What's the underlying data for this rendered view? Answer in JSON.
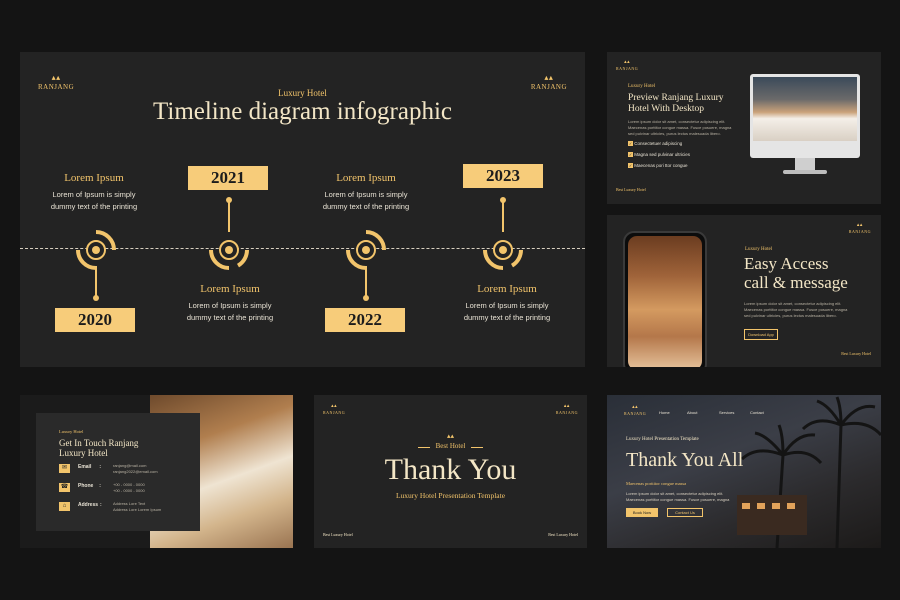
{
  "brand": "RANJANG",
  "timeline_slide": {
    "eyebrow": "Luxury Hotel",
    "title": "Timeline diagram infographic",
    "items": [
      {
        "year": "2020",
        "heading": "Lorem Ipsum",
        "text_l1": "Lorem of Ipsum is simply",
        "text_l2": "dummy text of the printing"
      },
      {
        "year": "2021",
        "heading": "Lorem Ipsum",
        "text_l1": "Lorem of Ipsum is simply",
        "text_l2": "dummy text of the printing"
      },
      {
        "year": "2022",
        "heading": "Lorem Ipsum",
        "text_l1": "Lorem of Ipsum is simply",
        "text_l2": "dummy text of the printing"
      },
      {
        "year": "2023",
        "heading": "Lorem Ipsum",
        "text_l1": "Lorem of Ipsum is simply",
        "text_l2": "dummy text of the printing"
      }
    ]
  },
  "desktop_slide": {
    "eyebrow": "Luxury Hotel",
    "title_l1": "Preview Ranjang Luxury",
    "title_l2": "Hotel With Desktop",
    "body_l1": "Lorem ipsum dolor sit amet, consectetur adipiscing elit.",
    "body_l2": "Maecenas porttitor congue massa. Fusce posuere, magna",
    "body_l3": "sed pulvinar ultricies, purus lectus malesuada libero.",
    "checks": [
      "Consectetuer adipiscing",
      "Magna sed pulvinar ultricies",
      "Maecenas pori ttor congue"
    ],
    "footer": "Best Luxury Hotel"
  },
  "mobile_slide": {
    "eyebrow": "Luxury Hotel",
    "title_l1": "Easy Access",
    "title_l2": "call & message",
    "body_l1": "Lorem ipsum dolor sit amet, consectetur adipiscing elit.",
    "body_l2": "Maecenas porttitor congue massa. Fusce posuere, magna",
    "body_l3": "sed pulvinar ultricies, purus lectus malesuada libero.",
    "button": "Download App",
    "footer": "Best Luxury Hotel"
  },
  "contact_slide": {
    "eyebrow": "Luxury Hotel",
    "title_l1": "Get In Touch Ranjang",
    "title_l2": "Luxury Hotel",
    "email_label": "Email",
    "email_l1": "ranjang@mail.com",
    "email_l2": "ranjang2022@email.com",
    "phone_label": "Phone",
    "phone_l1": "+00 - 0000 - 0000",
    "phone_l2": "+00 - 0000 - 0000",
    "address_label": "Address",
    "address_l1": "Address Lore Text",
    "address_l2": "Address Lore Lorem Ipsum"
  },
  "thanks_slide": {
    "eyebrow": "Best Hotel",
    "title": "Thank You",
    "subtitle": "Luxury Hotel Presentation Template",
    "footer_left": "Best Luxury Hotel",
    "footer_right": "Best Luxury Hotel"
  },
  "thanks_all_slide": {
    "nav": [
      "Home",
      "About",
      "Services",
      "Contact"
    ],
    "eyebrow": "Luxury Hotel Presentation Template",
    "title": "Thank You All",
    "tagline": "Maecenas porttitor congue massa",
    "body_l1": "Lorem ipsum dolor sit amet, consectetur adipiscing elit.",
    "body_l2": "Maecenas porttitor congue massa. Fusce posuere, magna",
    "button_primary": "Book Now",
    "button_secondary": "Contact Us"
  },
  "colors": {
    "accent": "#f2c46b",
    "slide_bg": "#232323",
    "page_bg": "#141414"
  }
}
